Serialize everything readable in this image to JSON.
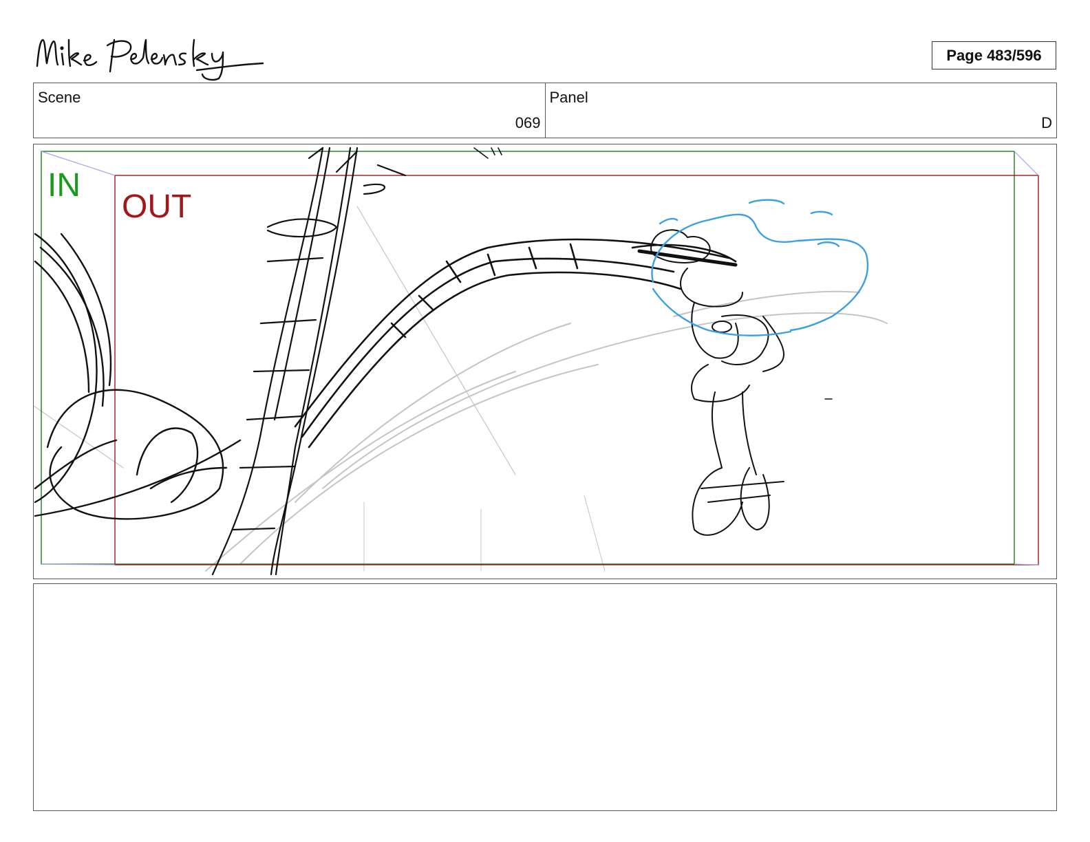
{
  "header": {
    "signature_text": "Mike Pelensky",
    "page_label": "Page 483/596"
  },
  "info": {
    "scene_label": "Scene",
    "scene_value": "069",
    "panel_label": "Panel",
    "panel_value": "D"
  },
  "frame_guides": {
    "in_label": "IN",
    "out_label": "OUT",
    "in_color": "#1a9a1a",
    "out_color": "#a01818",
    "effect_color": "#3aa0e0"
  },
  "notes": {
    "text": ""
  }
}
